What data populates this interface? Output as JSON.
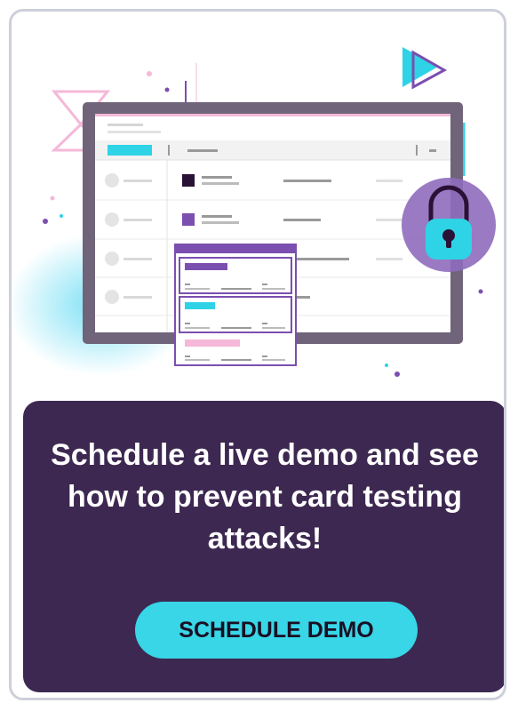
{
  "promo": {
    "headline": "Schedule a live demo and see how to prevent card testing attacks!",
    "cta_label": "SCHEDULE DEMO"
  },
  "colors": {
    "panel_background": "#3d2851",
    "cta_background": "#38d6e6",
    "cta_text": "#1a0f24",
    "accent_purple": "#7b4fb0",
    "accent_cyan": "#2ed3e6",
    "accent_pink": "#f5b8d8"
  },
  "icons": [
    "play-icon",
    "lock-icon",
    "hourglass-icon"
  ]
}
